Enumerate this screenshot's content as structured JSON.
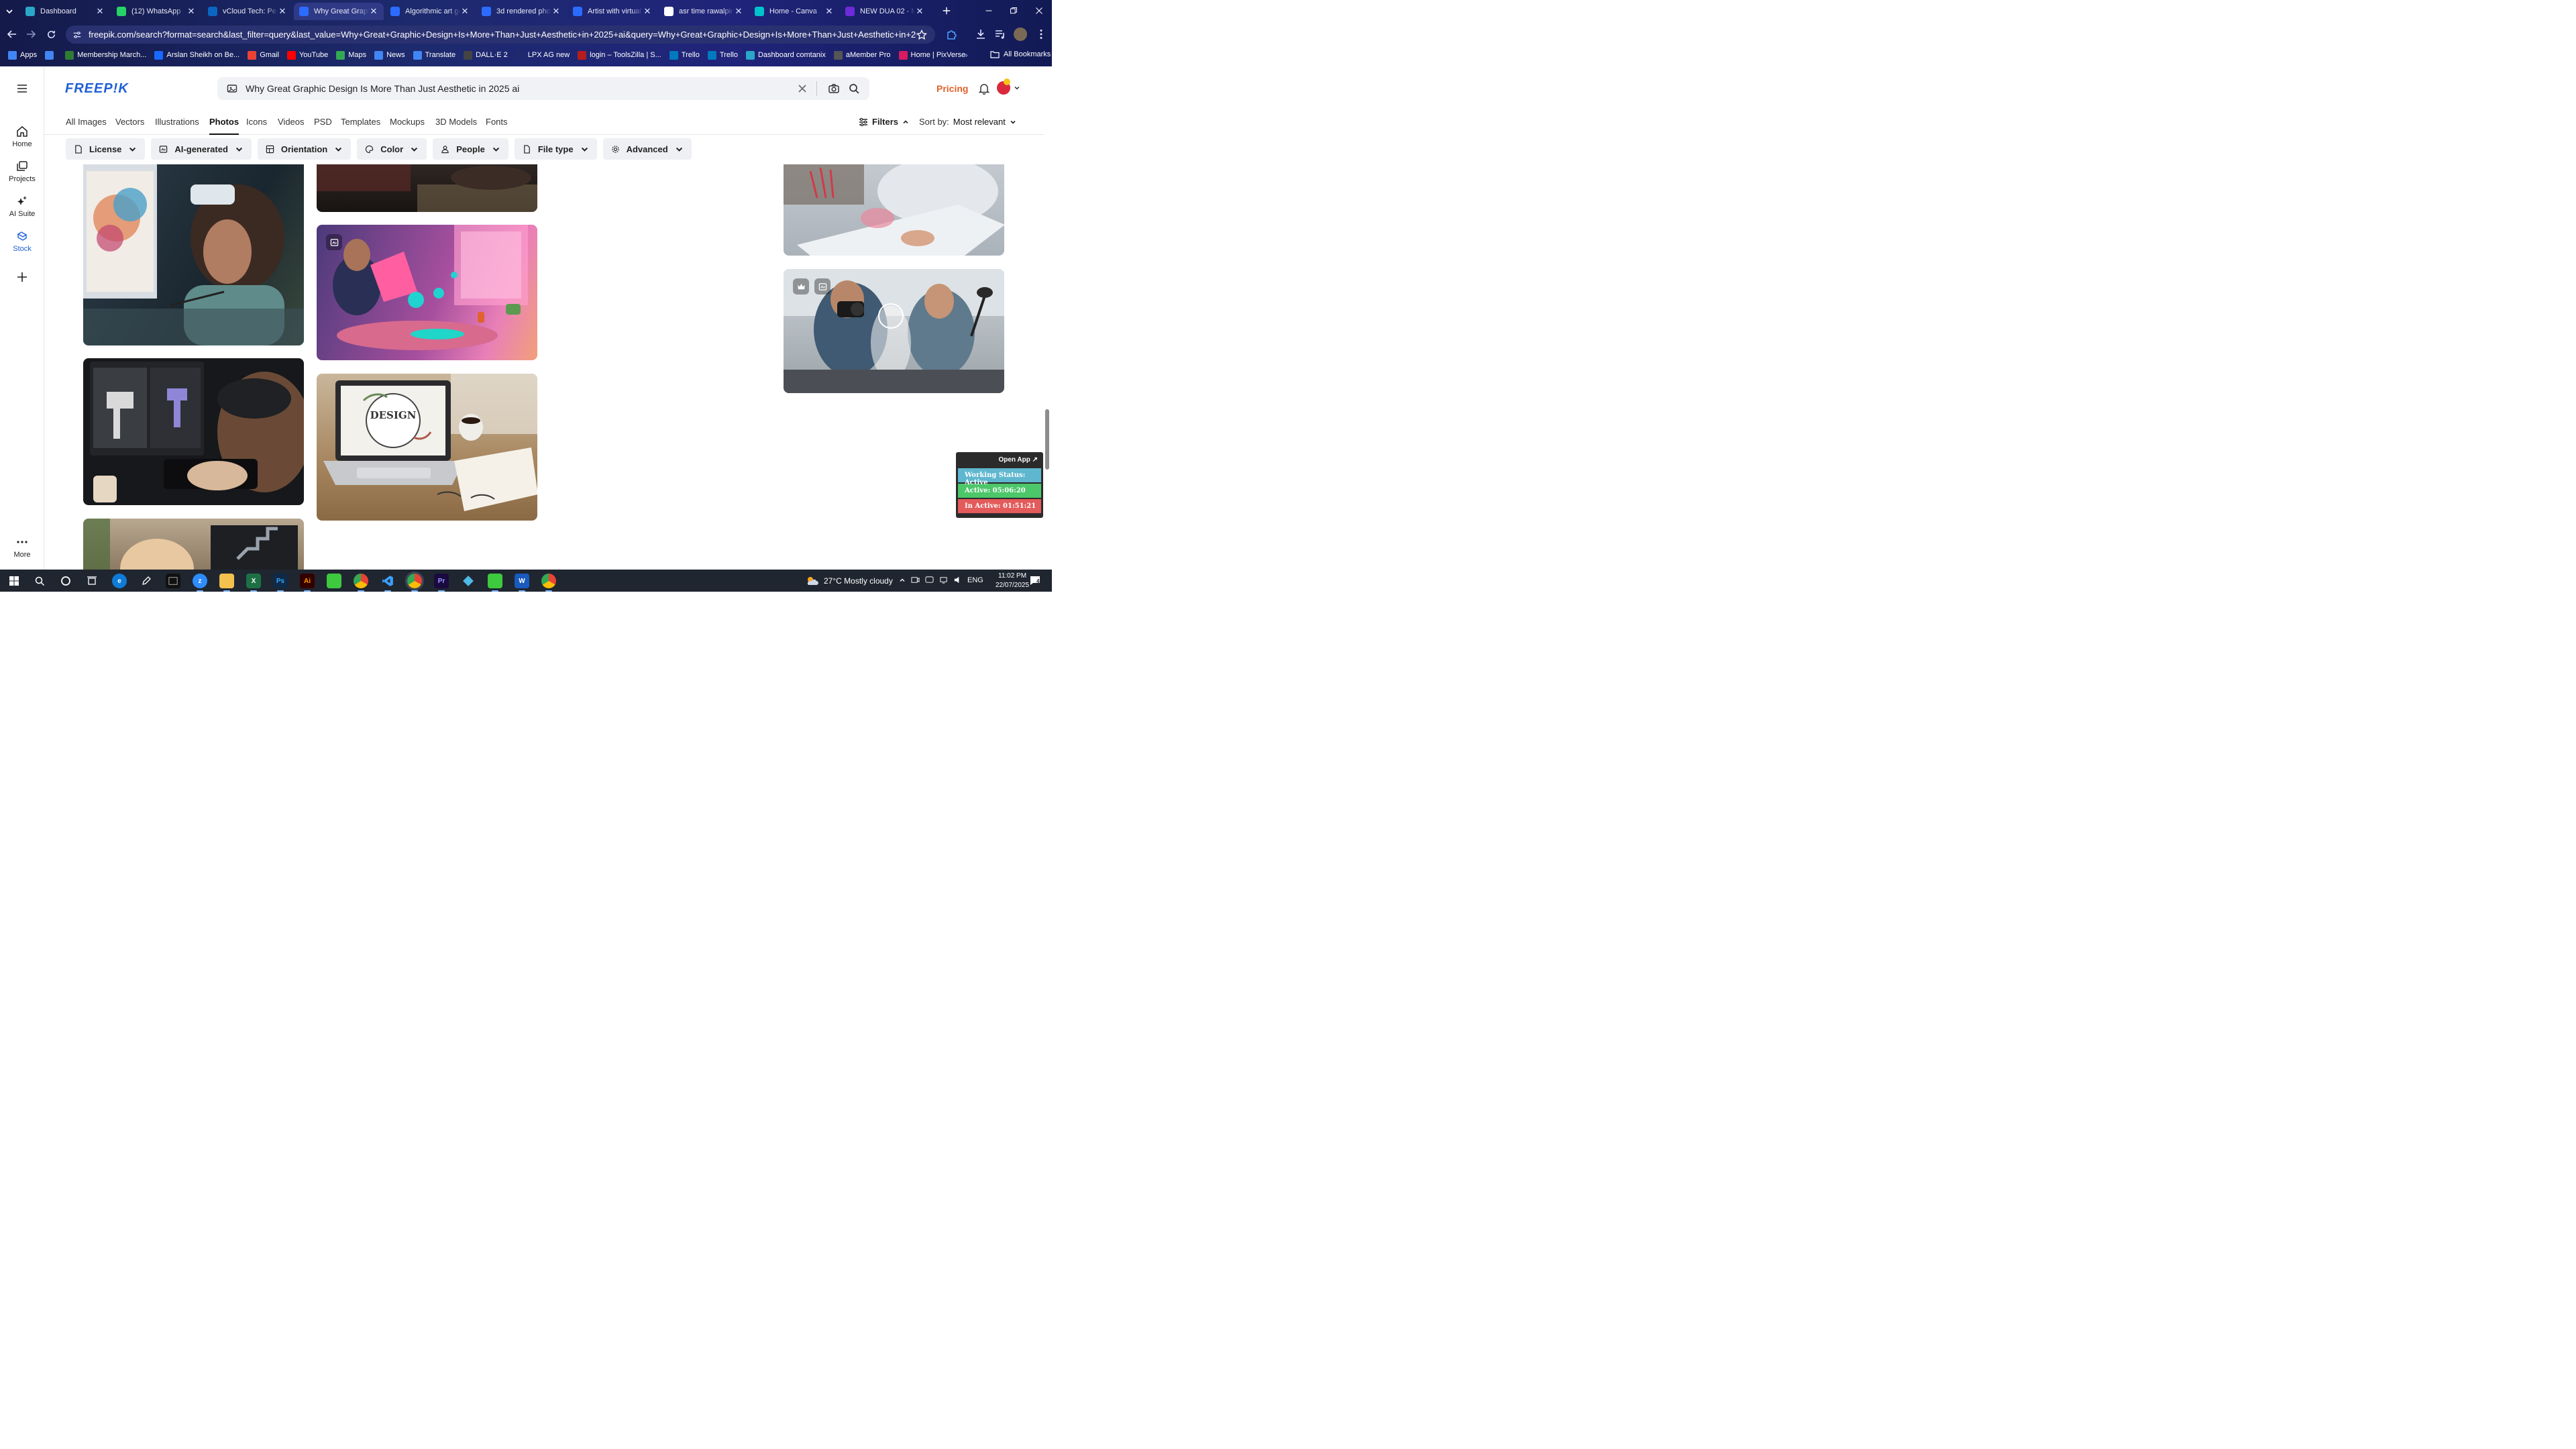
{
  "browser": {
    "tabs": [
      {
        "title": "Dashboard",
        "favicon_color": "#2aa7c9",
        "active": false
      },
      {
        "title": "(12) WhatsApp",
        "favicon_color": "#25d366",
        "active": false
      },
      {
        "title": "vCloud Tech: People",
        "favicon_color": "#0a66c2",
        "active": false
      },
      {
        "title": "Why Great Graphic",
        "favicon_color": "#2b6cff",
        "active": true
      },
      {
        "title": "Algorithmic art ge",
        "favicon_color": "#2b6cff",
        "active": false
      },
      {
        "title": "3d rendered phot",
        "favicon_color": "#2b6cff",
        "active": false
      },
      {
        "title": "Artist with virtual",
        "favicon_color": "#2b6cff",
        "active": false
      },
      {
        "title": "asr time rawalpindi",
        "favicon_color": "#ffffff",
        "active": false
      },
      {
        "title": "Home - Canva",
        "favicon_color": "#00c4cc",
        "active": false
      },
      {
        "title": "NEW DUA 02 - M",
        "favicon_color": "#6d2bd9",
        "active": false
      }
    ],
    "url": "freepik.com/search?format=search&last_filter=query&last_value=Why+Great+Graphic+Design+Is+More+Than+Just+Aesthetic+in+2025+ai&query=Why+Great+Graphic+Design+Is+More+Than+Just+Aesthetic+in+2025+ai&type=photo",
    "bookmarks": [
      {
        "label": "Apps",
        "color": "#4285f4"
      },
      {
        "label": "",
        "color": "#4285f4"
      },
      {
        "label": "Membership March...",
        "color": "#2e7d32"
      },
      {
        "label": "Arslan Sheikh on Be...",
        "color": "#1769ff"
      },
      {
        "label": "Gmail",
        "color": "#ea4335"
      },
      {
        "label": "YouTube",
        "color": "#ff0000"
      },
      {
        "label": "Maps",
        "color": "#34a853"
      },
      {
        "label": "News",
        "color": "#4285f4"
      },
      {
        "label": "Translate",
        "color": "#4285f4"
      },
      {
        "label": "DALL·E 2",
        "color": "#444444"
      },
      {
        "label": "LPX AG new",
        "color": "#1e2a6e"
      },
      {
        "label": "login – ToolsZilla | S...",
        "color": "#b71c1c"
      },
      {
        "label": "Trello",
        "color": "#0079bf"
      },
      {
        "label": "Trello",
        "color": "#0079bf"
      },
      {
        "label": "Dashboard comtanix",
        "color": "#2aa7c9"
      },
      {
        "label": "aMember Pro",
        "color": "#555555"
      },
      {
        "label": "Home | PixVerse",
        "color": "#d81b60"
      }
    ],
    "all_bookmarks": "All Bookmarks"
  },
  "sidebar": {
    "items": [
      {
        "label": "Home",
        "icon": "home-icon"
      },
      {
        "label": "Projects",
        "icon": "projects-icon"
      },
      {
        "label": "AI Suite",
        "icon": "sparkle-icon"
      },
      {
        "label": "Stock",
        "icon": "stock-icon"
      },
      {
        "label": "",
        "icon": "plus-icon"
      }
    ],
    "more": "More"
  },
  "header": {
    "logo": "FREEP!K",
    "search_value": "Why Great Graphic Design Is More Than Just Aesthetic in 2025 ai",
    "pricing": "Pricing"
  },
  "categories": [
    "All Images",
    "Vectors",
    "Illustrations",
    "Photos",
    "Icons",
    "Videos",
    "PSD",
    "Templates",
    "Mockups",
    "3D Models",
    "Fonts"
  ],
  "active_category": "Photos",
  "filters_label": "Filters",
  "sort": {
    "label": "Sort by:",
    "value": "Most relevant"
  },
  "chips": [
    "License",
    "AI-generated",
    "Orientation",
    "Color",
    "People",
    "File type",
    "Advanced"
  ],
  "laptop_screen_text": "DESIGN",
  "tracker": {
    "open_app": "Open App ↗",
    "working_status": "Working Status: Active",
    "active_time": "Active: 05:06:20",
    "inactive_time": "In Active: 01:51:21",
    "colors": {
      "status": "#5fb7cf",
      "active": "#4cc76a",
      "inactive": "#e35b5b"
    }
  },
  "taskbar": {
    "weather": "27°C  Mostly cloudy",
    "language": "ENG",
    "time": "11:02 PM",
    "date": "22/07/2025",
    "notification_count": "4"
  }
}
